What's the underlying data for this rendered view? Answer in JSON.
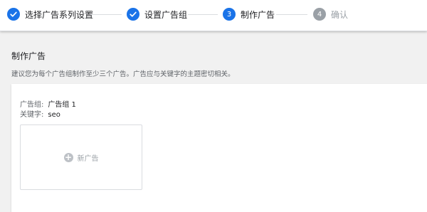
{
  "stepper": {
    "steps": [
      {
        "number": "",
        "label": "选择广告系列设置",
        "state": "done",
        "icon": "check-icon"
      },
      {
        "number": "",
        "label": "设置广告组",
        "state": "done",
        "icon": "check-icon"
      },
      {
        "number": "3",
        "label": "制作广告",
        "state": "active"
      },
      {
        "number": "4",
        "label": "确认",
        "state": "todo"
      }
    ]
  },
  "main": {
    "title": "制作广告",
    "subtitle": "建议您为每个广告组制作至少三个广告。广告应与关键字的主题密切相关。",
    "ad_group_label": "广告组:",
    "ad_group_value": "广告组 1",
    "keyword_label": "关键字:",
    "keyword_value": "seo",
    "new_ad_label": "新广告",
    "new_ad_icon": "plus-icon"
  },
  "colors": {
    "accent": "#1a73e8",
    "inactive": "#9aa0a6"
  }
}
